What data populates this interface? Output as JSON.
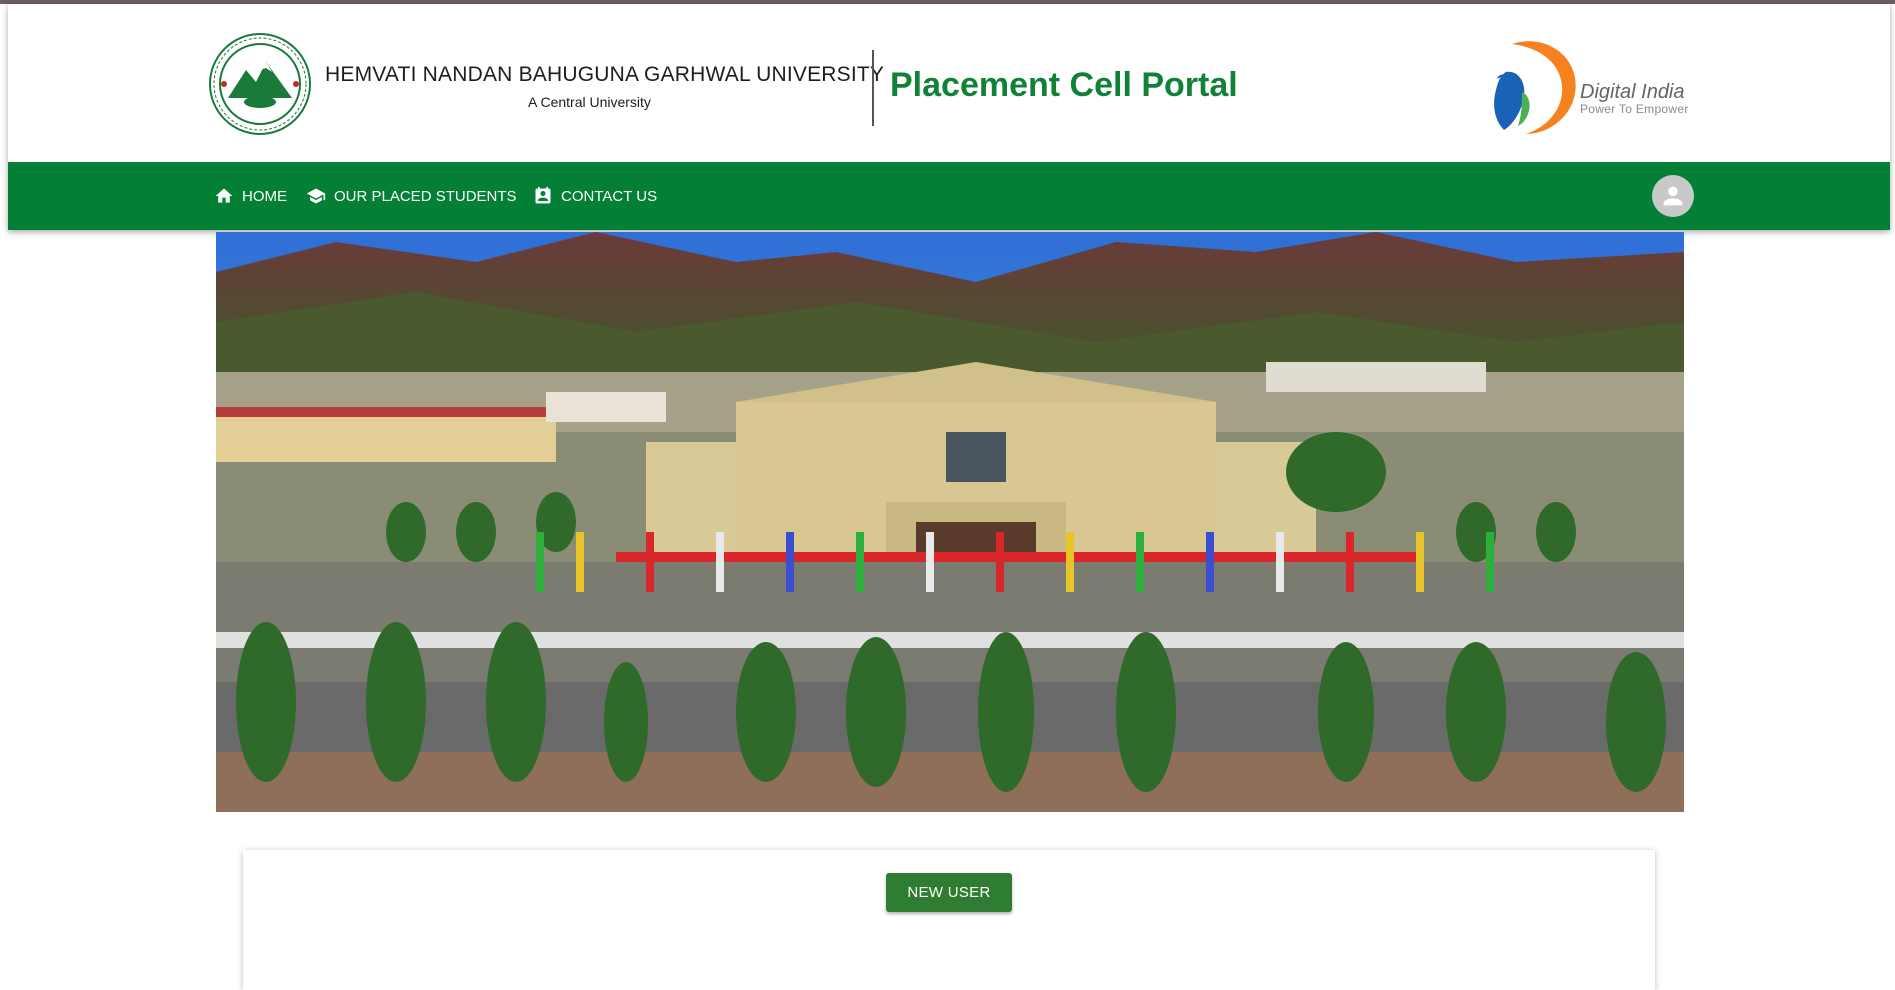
{
  "header": {
    "university_name": "HEMVATI NANDAN BAHUGUNA GARHWAL UNIVERSITY",
    "university_subtitle": "A Central University",
    "portal_title": "Placement Cell Portal",
    "partner_logo": {
      "title": "Digital India",
      "tagline": "Power To Empower"
    },
    "seal_icon": "university-seal-icon"
  },
  "nav": {
    "items": [
      {
        "label": "HOME",
        "icon": "home-icon"
      },
      {
        "label": "OUR PLACED STUDENTS",
        "icon": "graduation-cap-icon"
      },
      {
        "label": "CONTACT US",
        "icon": "contact-card-icon"
      }
    ],
    "user_icon": "account-circle-icon"
  },
  "colors": {
    "brand_green": "#037f36",
    "title_green": "#108238",
    "button_green": "#2e7d32"
  },
  "actions": {
    "new_user_label": "NEW USER"
  }
}
